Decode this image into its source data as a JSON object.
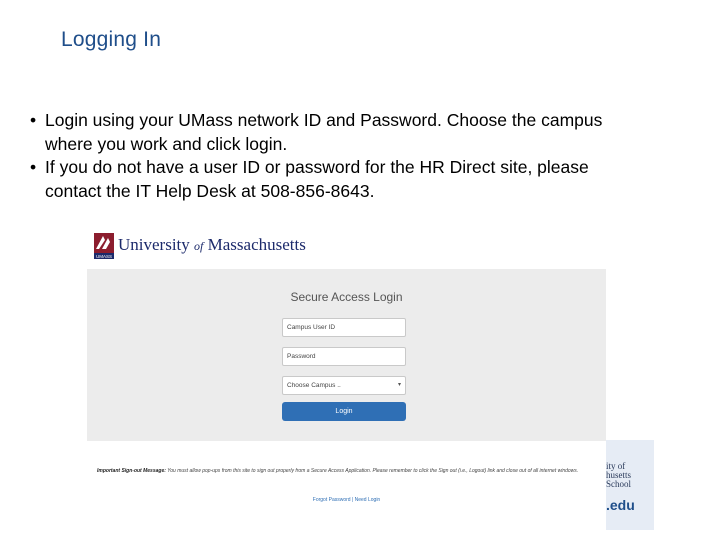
{
  "slide": {
    "title": "Logging In",
    "bullets": [
      "Login using your UMass network ID and Password. Choose the campus where you work and click login.",
      "If you do not have a user ID or password for the HR Direct site, please contact the IT Help Desk at 508-856-8643."
    ]
  },
  "screenshot": {
    "logo": {
      "mark": "UMASS",
      "word_pre": "University",
      "word_of": "of",
      "word_post": "Massachusetts"
    },
    "form": {
      "title": "Secure Access Login",
      "user_placeholder": "Campus User ID",
      "password_placeholder": "Password",
      "campus_select": "Choose Campus ..",
      "login_label": "Login"
    },
    "notice": {
      "label": "Important Sign-out Message:",
      "text": "You must allow pop-ups from this site to sign out properly from a Secure Access Application. Please remember to click the Sign out (i.e., Logout) link and close out of all internet windows."
    },
    "links": "Forgot Password | Need Login"
  },
  "corner": {
    "line1": "ity of",
    "line2": "husetts",
    "line3": "School",
    "edu": ".edu"
  },
  "colors": {
    "title": "#1f4e8a",
    "button": "#2f6fb5",
    "panel": "#ececec"
  }
}
